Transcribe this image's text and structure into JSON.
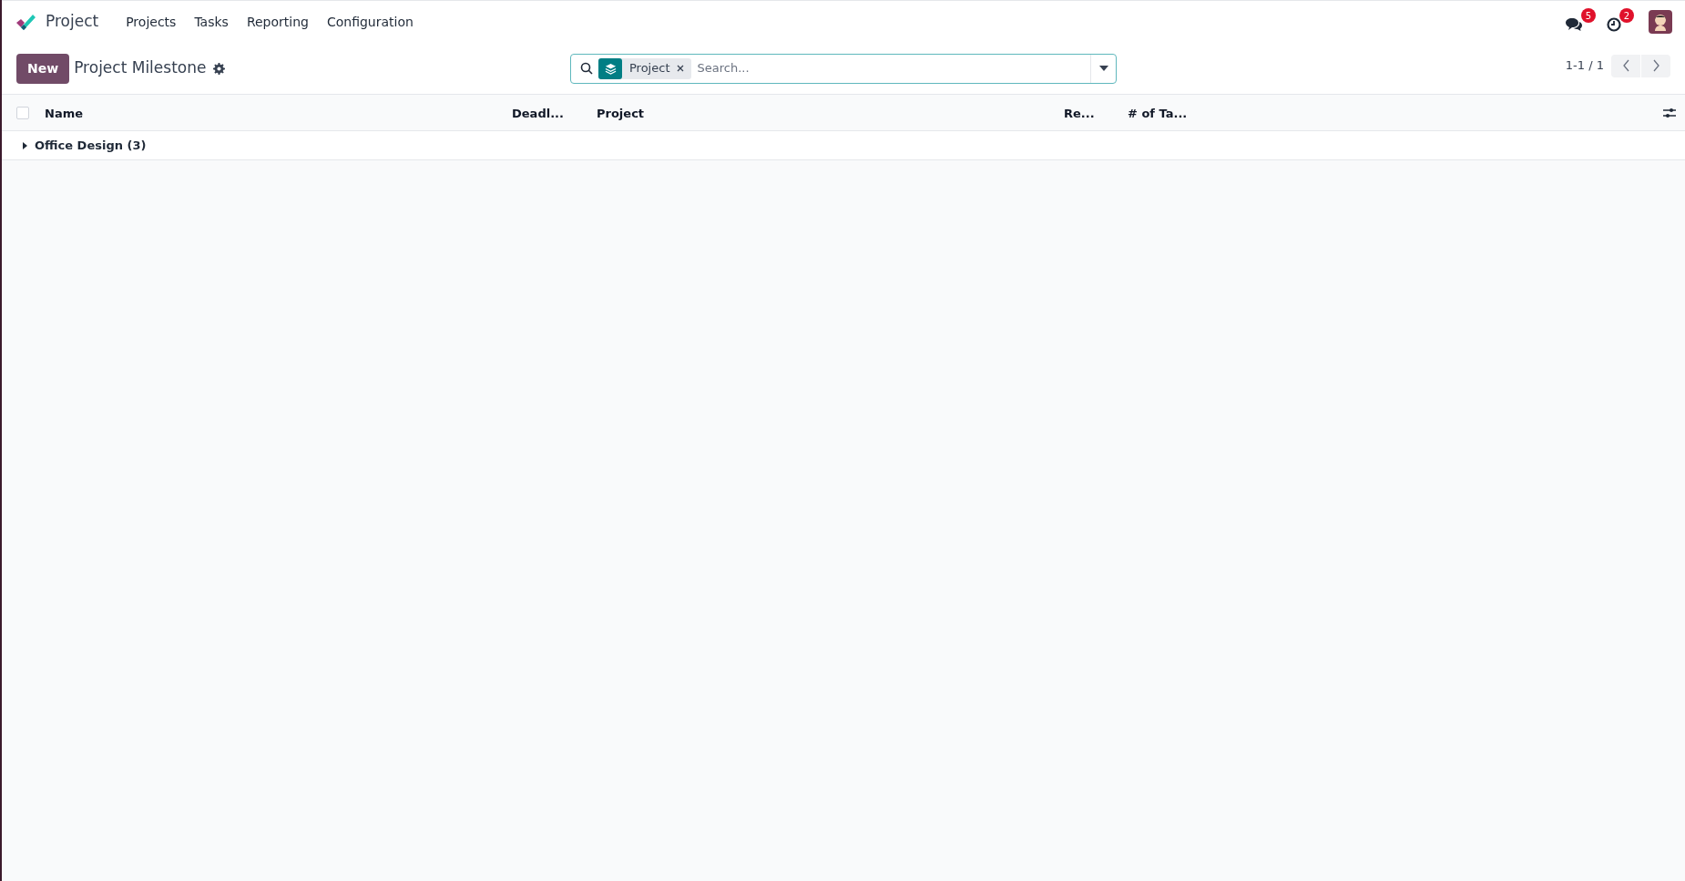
{
  "navbar": {
    "app_name": "Project",
    "menu": [
      "Projects",
      "Tasks",
      "Reporting",
      "Configuration"
    ],
    "messages_badge": "5",
    "activities_badge": "2"
  },
  "control_panel": {
    "new_button": "New",
    "title": "Project Milestone",
    "search": {
      "facets": [
        {
          "label": "Project"
        }
      ],
      "placeholder": "Search..."
    },
    "pager": "1-1 / 1"
  },
  "table": {
    "select_all_checked": false,
    "columns": [
      "Name",
      "Deadl...",
      "Project",
      "Re...",
      "# of Ta..."
    ],
    "groups": [
      {
        "label": "Office Design (3)",
        "expanded": false
      }
    ]
  }
}
